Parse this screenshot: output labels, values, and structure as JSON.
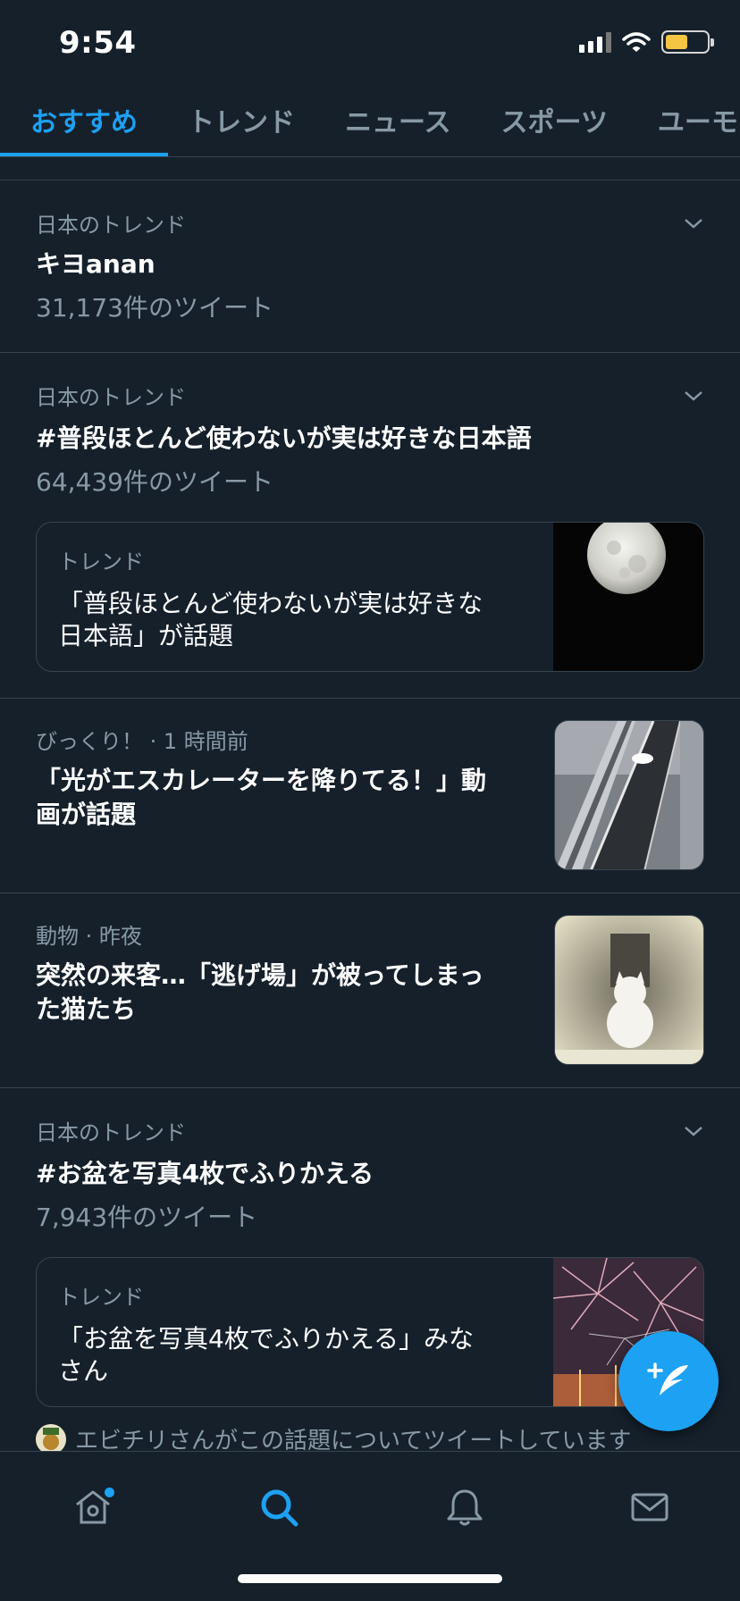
{
  "status_bar": {
    "time": "9:54"
  },
  "tabs": [
    {
      "label": "おすすめ",
      "active": true
    },
    {
      "label": "トレンド"
    },
    {
      "label": "ニュース"
    },
    {
      "label": "スポーツ"
    },
    {
      "label": "ユーモア"
    }
  ],
  "feed": {
    "trend1": {
      "meta": "日本のトレンド",
      "title": "キヨanan",
      "count": "31,173件のツイート"
    },
    "trend2": {
      "meta": "日本のトレンド",
      "title": "#普段ほとんど使わないが実は好きな日本語",
      "count": "64,439件のツイート",
      "card": {
        "meta": "トレンド",
        "title_line1": "「普段ほとんど使わないが実は好きな",
        "title_line2": "日本語」が話題"
      }
    },
    "news1": {
      "meta": "びっくり！ · 1 時間前",
      "title_line1": "「光がエスカレーターを降りてる！」動",
      "title_line2": "画が話題"
    },
    "news2": {
      "meta": "動物 · 昨夜",
      "title_line1": "突然の来客…「逃げ場」が被ってしまっ",
      "title_line2": "た猫たち"
    },
    "trend3": {
      "meta": "日本のトレンド",
      "title": "#お盆を写真4枚でふりかえる",
      "count": "7,943件のツイート",
      "card": {
        "meta": "トレンド",
        "title_line1": "「お盆を写真4枚でふりかえる」みな",
        "title_line2": "さん"
      },
      "tweeting": "エビチリさんがこの話題についてツイートしています"
    }
  },
  "colors": {
    "background": "#15202b",
    "accent": "#1da1f2",
    "muted": "#8899a6",
    "divider": "#38444d"
  },
  "icons": {
    "status": [
      "signal-icon",
      "wifi-icon",
      "battery-icon"
    ],
    "bottom_nav": [
      "home-icon",
      "search-icon",
      "notifications-icon",
      "messages-icon"
    ],
    "fab": "compose-tweet-icon"
  }
}
